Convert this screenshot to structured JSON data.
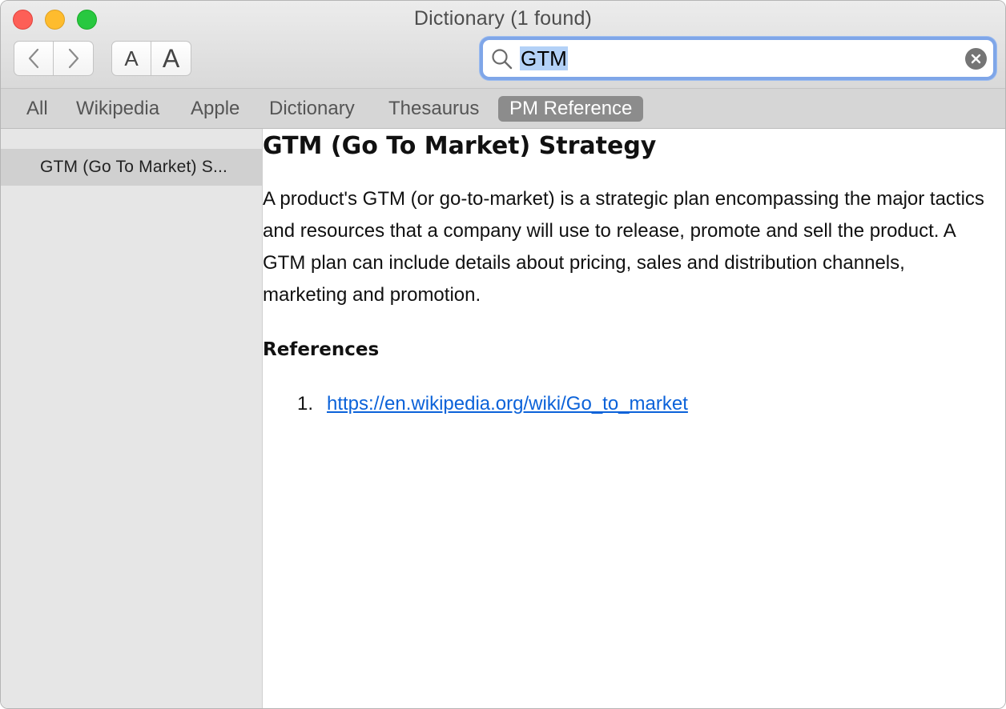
{
  "window": {
    "title": "Dictionary (1 found)"
  },
  "toolbar": {
    "back_icon": "chevron-left-icon",
    "forward_icon": "chevron-right-icon",
    "font_smaller_label": "A",
    "font_larger_label": "A"
  },
  "search": {
    "value": "GTM",
    "icon": "magnifier-icon",
    "clear_icon": "clear-x-icon"
  },
  "scopes": [
    {
      "label": "All",
      "active": false
    },
    {
      "label": "Wikipedia",
      "active": false
    },
    {
      "label": "Apple",
      "active": false
    },
    {
      "label": "Dictionary",
      "active": false
    },
    {
      "label": "Thesaurus",
      "active": false
    },
    {
      "label": "PM Reference",
      "active": true
    }
  ],
  "sidebar": {
    "items": [
      {
        "label": "GTM (Go To Market) S...",
        "selected": true
      }
    ]
  },
  "entry": {
    "title": "GTM (Go To Market) Strategy",
    "body": "A product's GTM (or go-to-market) is a strategic plan encompassing the major tactics and resources that a company will use to release, promote and sell the product. A GTM plan can include details about pricing, sales and distribution channels, marketing and promotion.",
    "references_heading": "References",
    "references": [
      {
        "number": "1.",
        "url": "https://en.wikipedia.org/wiki/Go_to_market"
      }
    ]
  },
  "colors": {
    "accent": "#7fa6e8",
    "active_scope": "#8c8c8c",
    "link": "#0b62d9"
  }
}
